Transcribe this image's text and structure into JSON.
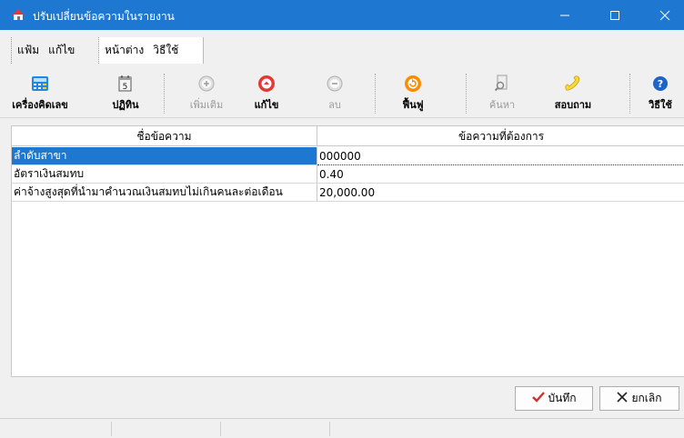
{
  "window": {
    "title": "ปรับเปลี่ยนข้อความในรายงาน"
  },
  "menu": {
    "group1": [
      "แฟ้ม",
      "แก้ไข"
    ],
    "group2": [
      "หน้าต่าง",
      "วิธีใช้"
    ]
  },
  "toolbar": {
    "calculator": "เครื่องคิดเลข",
    "calendar": "ปฏิทิน",
    "add": "เพิ่มเติม",
    "edit": "แก้ไข",
    "delete": "ลบ",
    "restore": "ฟื้นฟู",
    "search": "ค้นหา",
    "inquire": "สอบถาม",
    "help": "วิธีใช้",
    "calendar_day": "5"
  },
  "grid": {
    "headers": [
      "ชื่อข้อความ",
      "ข้อความที่ต้องการ"
    ],
    "rows": [
      {
        "name": "ลำดับสาขา",
        "value": "000000"
      },
      {
        "name": "อัตราเงินสมทบ",
        "value": "0.40"
      },
      {
        "name": "ค่าจ้างสูงสุดที่นำมาคำนวณเงินสมทบไม่เกินคนละต่อเดือน",
        "value": "20,000.00"
      }
    ]
  },
  "buttons": {
    "save": "บันทึก",
    "cancel": "ยกเลิก"
  },
  "colors": {
    "titlebar": "#1e78d2",
    "selection": "#1e78d2"
  }
}
